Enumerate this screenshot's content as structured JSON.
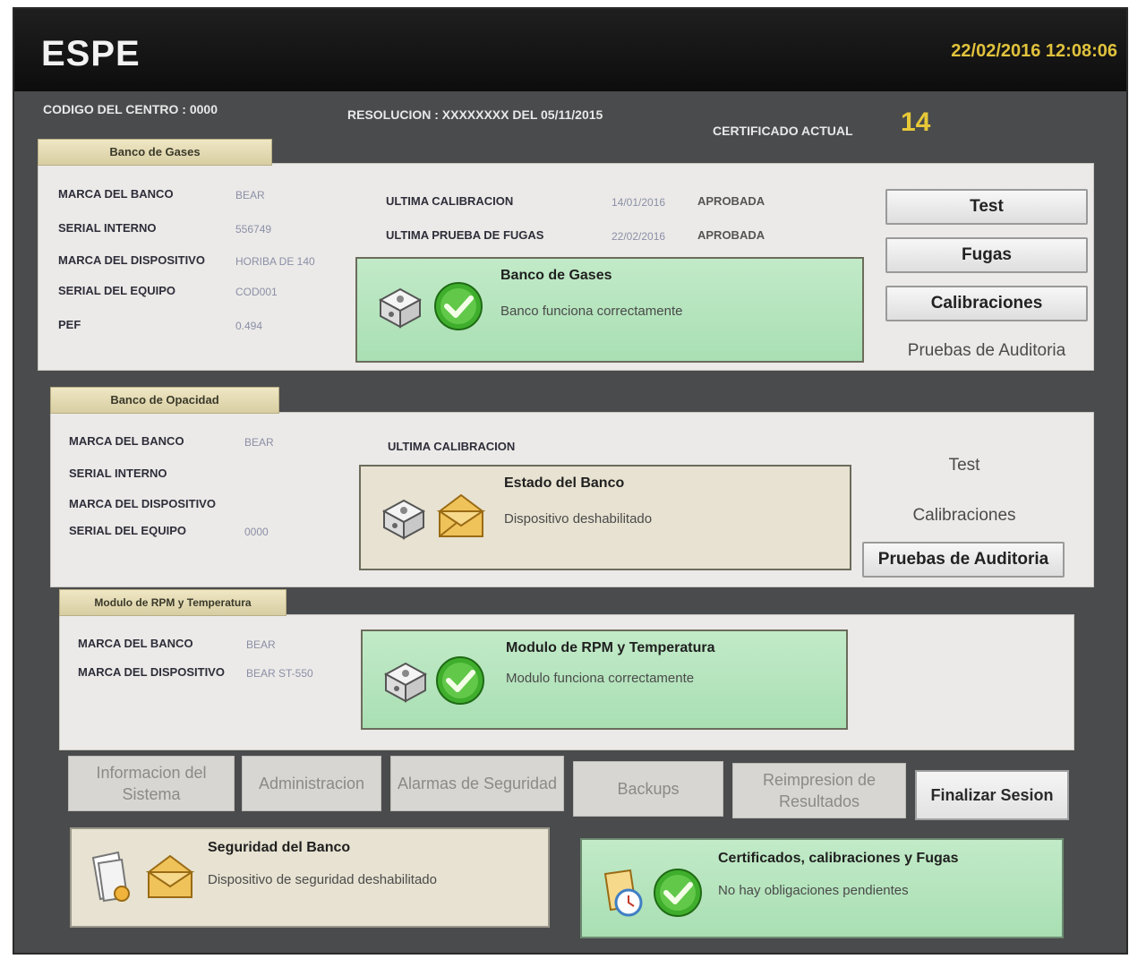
{
  "header": {
    "title": "ESPE",
    "datetime": "22/02/2016 12:08:06",
    "center_code": "CODIGO DEL CENTRO : 0000",
    "resolution": "RESOLUCION : XXXXXXXX DEL 05/11/2015",
    "cert_label": "CERTIFICADO ACTUAL",
    "cert_number": "14"
  },
  "gas_bank": {
    "tab": "Banco de Gases",
    "fields": [
      {
        "label": "MARCA DEL BANCO",
        "value": "BEAR"
      },
      {
        "label": "SERIAL INTERNO",
        "value": "556749"
      },
      {
        "label": "MARCA DEL DISPOSITIVO",
        "value": "HORIBA DE 140"
      },
      {
        "label": "SERIAL DEL EQUIPO",
        "value": "COD001"
      },
      {
        "label": "PEF",
        "value": "0.494"
      }
    ],
    "last_calibration_label": "ULTIMA CALIBRACION",
    "last_calibration_date": "14/01/2016",
    "last_calibration_status": "APROBADA",
    "last_leak_label": "ULTIMA PRUEBA DE FUGAS",
    "last_leak_date": "22/02/2016",
    "last_leak_status": "APROBADA",
    "status_title": "Banco de Gases",
    "status_text": "Banco funciona correctamente",
    "buttons": {
      "test": "Test",
      "leaks": "Fugas",
      "calibrations": "Calibraciones",
      "audit": "Pruebas de Auditoria"
    }
  },
  "opacity_bank": {
    "tab": "Banco de Opacidad",
    "fields": [
      {
        "label": "MARCA DEL BANCO",
        "value": "BEAR"
      },
      {
        "label": "SERIAL INTERNO",
        "value": ""
      },
      {
        "label": "MARCA DEL DISPOSITIVO",
        "value": ""
      },
      {
        "label": "SERIAL DEL EQUIPO",
        "value": "0000"
      }
    ],
    "last_calibration_label": "ULTIMA CALIBRACION",
    "status_title": "Estado del Banco",
    "status_text": "Dispositivo deshabilitado",
    "buttons": {
      "test": "Test",
      "calibrations": "Calibraciones",
      "audit": "Pruebas de Auditoria"
    }
  },
  "rpm_module": {
    "tab": "Modulo de RPM y Temperatura",
    "fields": [
      {
        "label": "MARCA DEL BANCO",
        "value": "BEAR"
      },
      {
        "label": "MARCA DEL DISPOSITIVO",
        "value": "BEAR ST-550"
      }
    ],
    "status_title": "Modulo de RPM y Temperatura",
    "status_text": "Modulo funciona correctamente"
  },
  "nav": {
    "info": "Informacion del Sistema",
    "admin": "Administracion",
    "alarms": "Alarmas de Seguridad",
    "backups": "Backups",
    "reprint": "Reimpresion de Resultados",
    "logout": "Finalizar Sesion"
  },
  "bank_security": {
    "title": "Seguridad del Banco",
    "text": "Dispositivo de seguridad deshabilitado"
  },
  "certificates": {
    "title": "Certificados, calibraciones y Fugas",
    "text": "No hay obligaciones pendientes"
  }
}
